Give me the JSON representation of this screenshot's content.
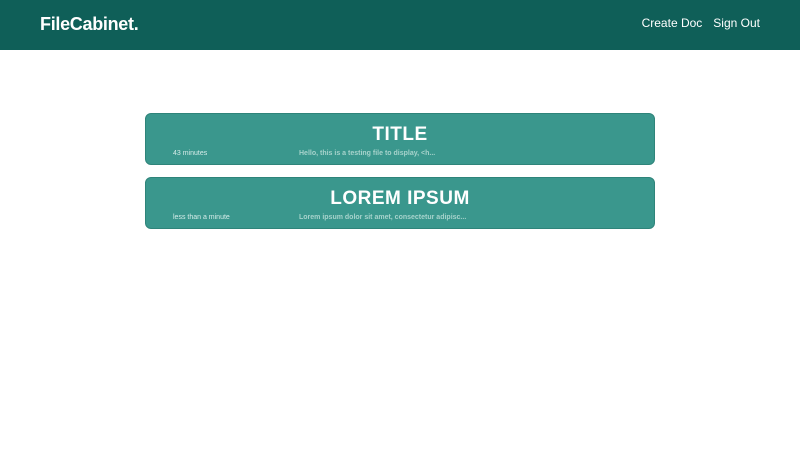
{
  "navbar": {
    "brand": "FileCabinet.",
    "links": [
      {
        "label": "Create Doc"
      },
      {
        "label": "Sign Out"
      }
    ]
  },
  "documents": [
    {
      "title": "TITLE",
      "time": "43 minutes",
      "preview": "Hello, this is a testing file to display, <h..."
    },
    {
      "title": "LOREM IPSUM",
      "time": "less than a minute",
      "preview": "Lorem ipsum dolor sit amet, consectetur adipisc..."
    }
  ],
  "colors": {
    "navbar": "#0f5f58",
    "card": "#3a978d",
    "page_background": "#ffffff"
  }
}
